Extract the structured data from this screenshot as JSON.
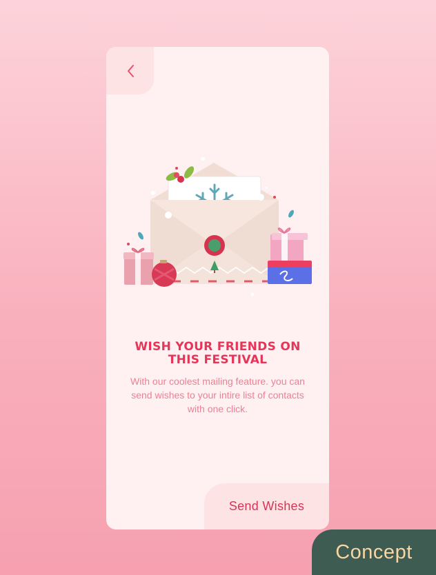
{
  "onboarding": {
    "back_icon": "chevron-left-icon",
    "title": "WISH YOUR FRIENDS ON THIS FESTIVAL",
    "description": "With our coolest mailing feature. you can send wishes to your intire list of contacts with one click.",
    "cta_label": "Send Wishes"
  },
  "badge": {
    "label": "Concept"
  },
  "colors": {
    "background": "#fbc0cb",
    "card": "#fff1f1",
    "tab": "#fde3e4",
    "accent": "#e53559",
    "body_text": "#ec7f93",
    "badge_bg": "#3f5c53",
    "badge_text": "#f7d6a4"
  }
}
